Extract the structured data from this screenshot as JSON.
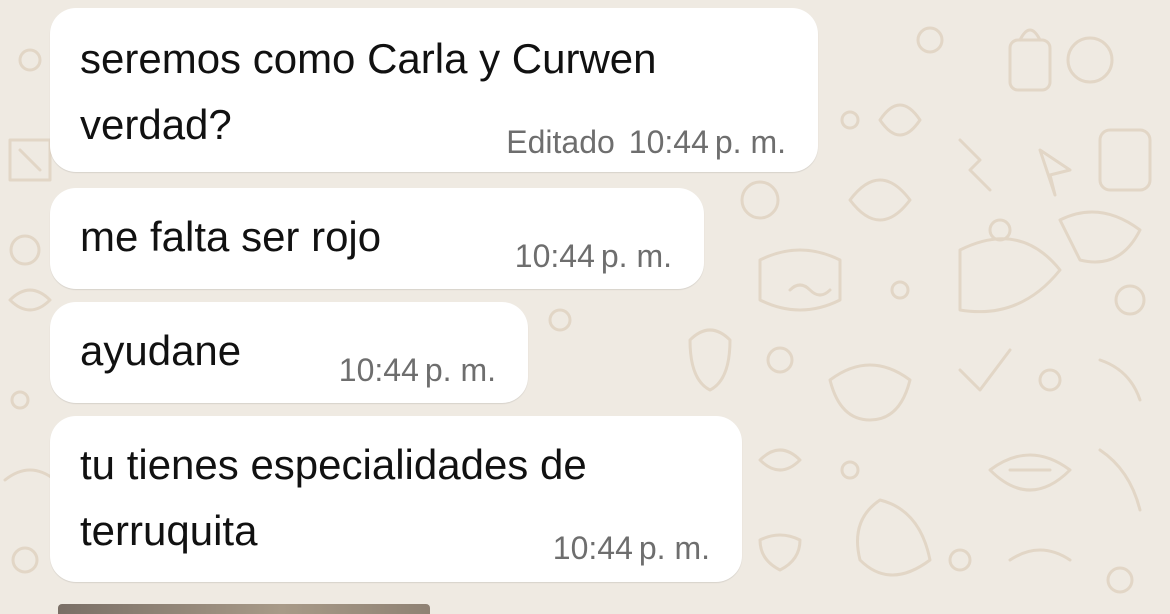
{
  "colors": {
    "wallpaper": "#efeae2",
    "doodles": "#e2d6c6",
    "bubble": "#ffffff",
    "text": "#111111",
    "meta": "#6e6e6e"
  },
  "messages": [
    {
      "text": "seremos como Carla y Curwen\nverdad?",
      "edited": "Editado",
      "time": "10:44",
      "ampm": "p. m."
    },
    {
      "text": "me falta ser rojo",
      "time": "10:44",
      "ampm": "p. m."
    },
    {
      "text": "ayudane",
      "time": "10:44",
      "ampm": "p. m."
    },
    {
      "text": "tu tienes especialidades de\nterruquita",
      "time": "10:44",
      "ampm": "p. m."
    }
  ],
  "icons": {
    "wallpaper": "whatsapp-doodle-pattern"
  }
}
